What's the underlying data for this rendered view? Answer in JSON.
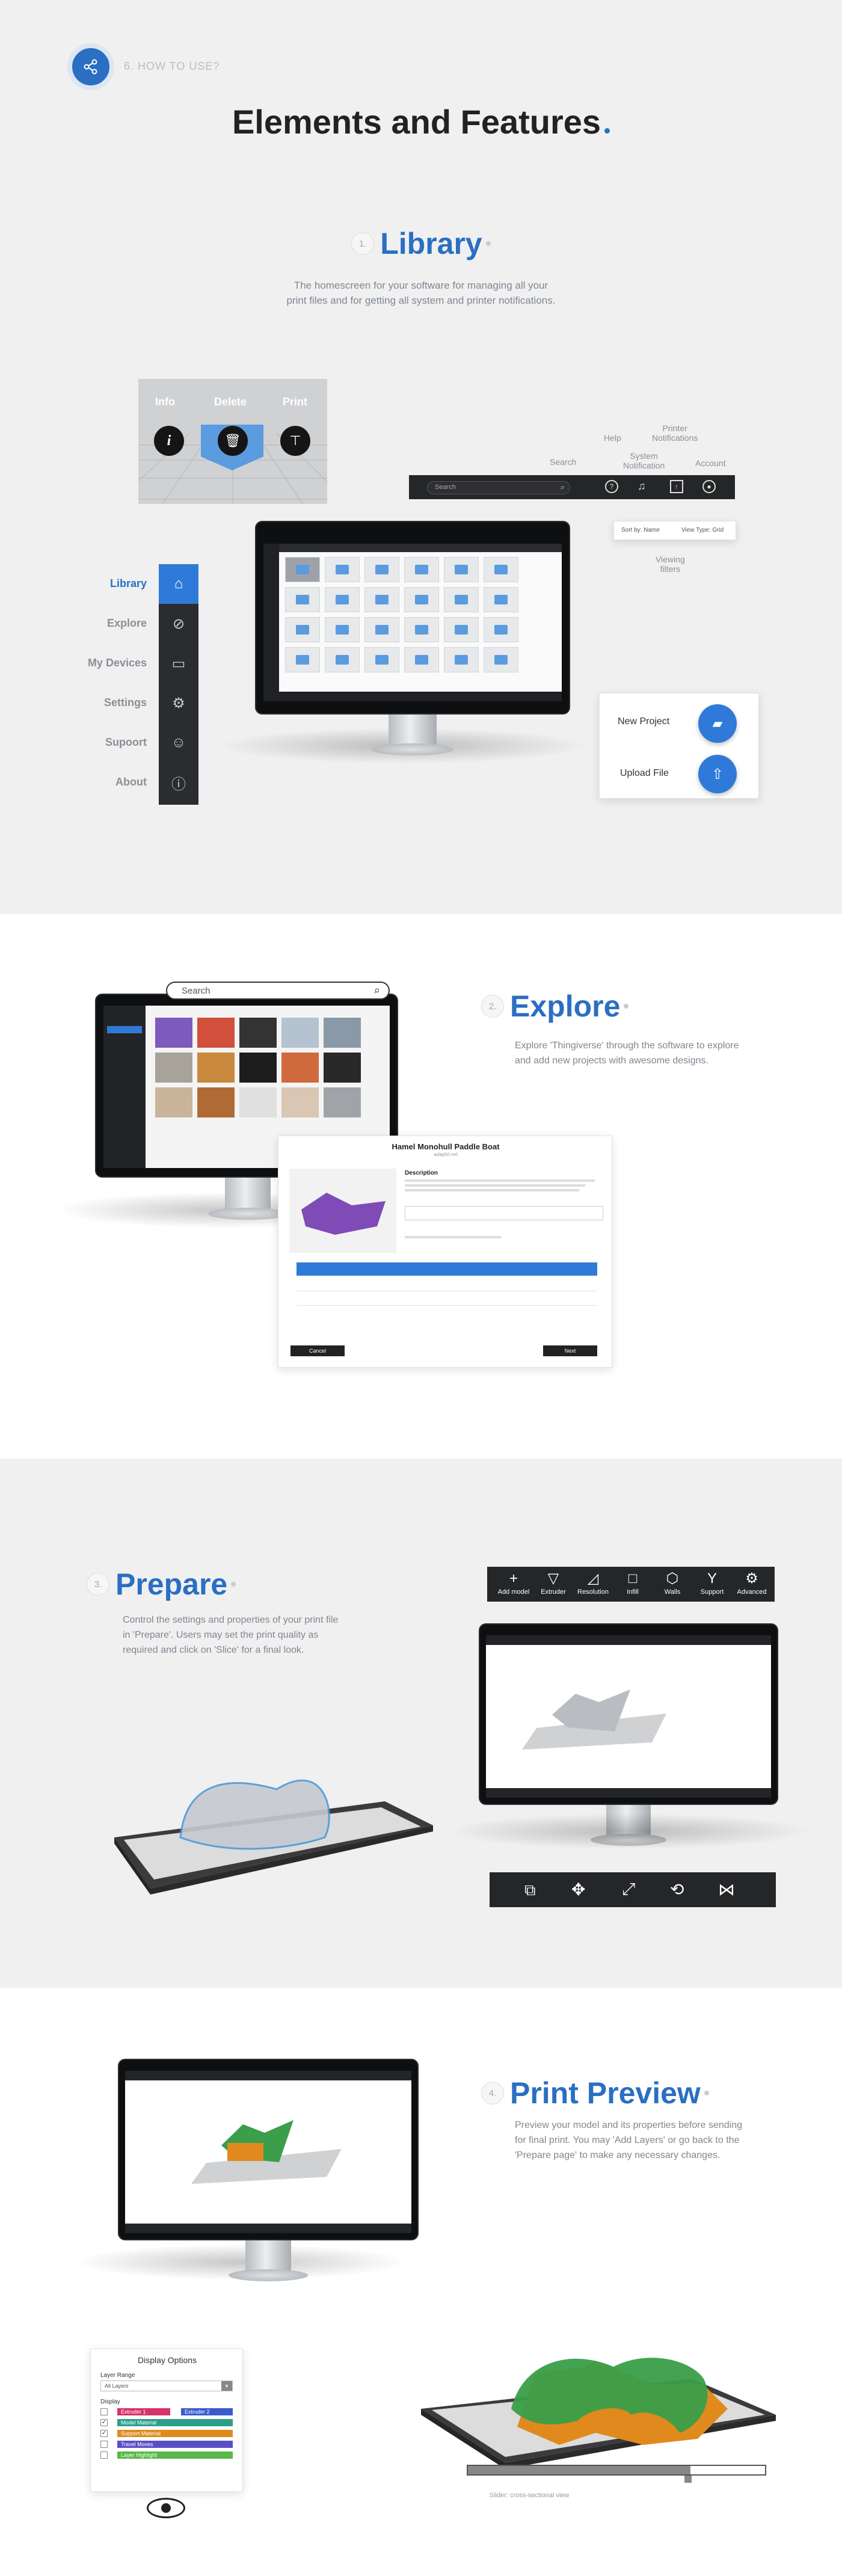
{
  "header": {
    "step_label": "6. HOW TO USE?",
    "title": "Elements and Features"
  },
  "library": {
    "num": "1.",
    "title": "Library",
    "desc1": "The homescreen for your software for managing all your",
    "desc2": "print files and for getting all system and printer notifications.",
    "popup": {
      "info": "Info",
      "delete": "Delete",
      "print": "Print"
    },
    "topbar_labels": {
      "search": "Search",
      "help": "Help",
      "system1": "System",
      "system2": "Notification",
      "printer1": "Printer",
      "printer2": "Notifications",
      "account": "Account"
    },
    "search_placeholder": "Search",
    "filters": {
      "sort": "Sort by: Name",
      "view": "View Type: Grid"
    },
    "viewing1": "Viewing",
    "viewing2": "filters",
    "nav": [
      "Library",
      "Explore",
      "My Devices",
      "Settings",
      "Supoort",
      "About"
    ],
    "actions": {
      "new_project": "New Project",
      "upload_file": "Upload File"
    }
  },
  "explore": {
    "num": "2.",
    "title": "Explore",
    "desc1": "Explore 'Thingiverse' through the software to explore",
    "desc2": "and add new projects with awesome designs.",
    "search_placeholder": "Search",
    "dialog": {
      "title": "Hamel Monohull Paddle Boat",
      "subtitle": "adaphil.net",
      "desc_heading": "Description",
      "cancel": "Cancel",
      "next": "Next"
    }
  },
  "prepare": {
    "num": "3.",
    "title": "Prepare",
    "desc1": "Control the settings and properties of your print file",
    "desc2": "in 'Prepare'. Users may set the print quality as",
    "desc3": "required and click on 'Slice' for a final look.",
    "toolbar": [
      "Add model",
      "Extruder",
      "Resolution",
      "Infill",
      "Walls",
      "Support",
      "Advanced"
    ]
  },
  "preview": {
    "num": "4.",
    "title": "Print Preview",
    "desc1": "Preview your model and its properties before sending",
    "desc2": "for final print. You may 'Add Layers'  or go back to the",
    "desc3": "'Prepare page' to make any necessary changes.",
    "display_options": {
      "title": "Display Options",
      "layer_range": "Layer Range",
      "all_layers": "All Layers",
      "display": "Display",
      "items": [
        "Extruder 1",
        "Extruder 2",
        "Model Material",
        "Support Material",
        "Travel Moves",
        "Layer Highlight"
      ]
    },
    "caption": "Slider: cross-sectional view"
  },
  "colors": {
    "accent": "#2a6fc2",
    "model_green": "#3a9e4a",
    "model_orange": "#e08a1e"
  }
}
